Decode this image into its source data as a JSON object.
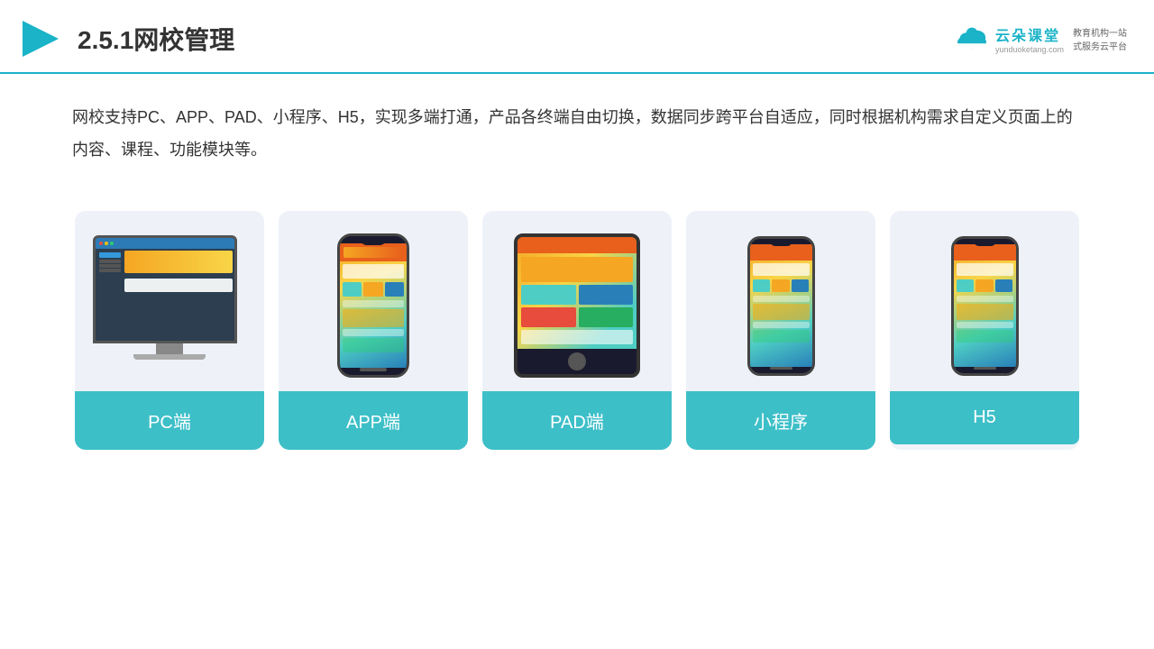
{
  "header": {
    "title": "2.5.1网校管理",
    "brand_name": "云朵课堂",
    "brand_url": "yunduoketang.com",
    "brand_tagline_line1": "教育机构一站",
    "brand_tagline_line2": "式服务云平台"
  },
  "description": {
    "text": "网校支持PC、APP、PAD、小程序、H5，实现多端打通，产品各终端自由切换，数据同步跨平台自适应，同时根据机构需求自定义页面上的内容、课程、功能模块等。"
  },
  "cards": [
    {
      "label": "PC端",
      "type": "pc"
    },
    {
      "label": "APP端",
      "type": "phone"
    },
    {
      "label": "PAD端",
      "type": "tablet"
    },
    {
      "label": "小程序",
      "type": "mini-phone"
    },
    {
      "label": "H5",
      "type": "mini-phone2"
    }
  ]
}
